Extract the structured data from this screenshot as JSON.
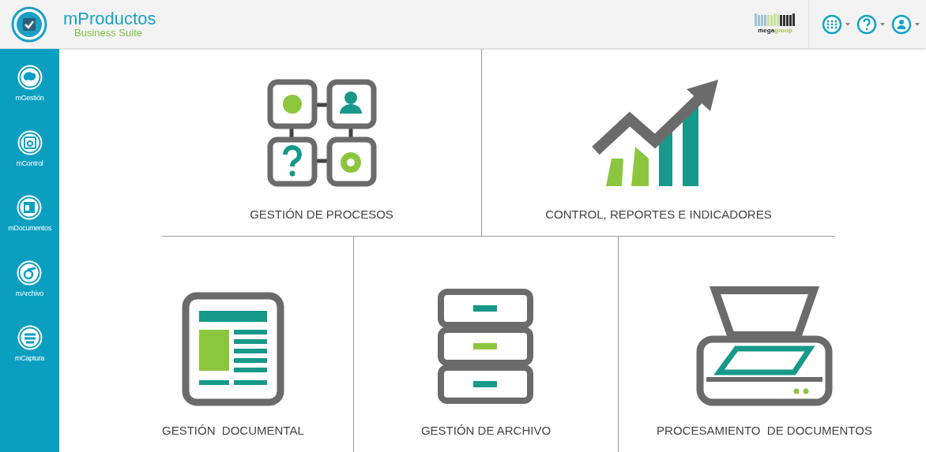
{
  "header": {
    "logo_title": "mProductos",
    "logo_subtitle": "Business Suite",
    "partner_logo": [
      "mega",
      "group"
    ]
  },
  "sidebar": {
    "items": [
      {
        "label": "mGestión",
        "kind": "gestion"
      },
      {
        "label": "mControl",
        "kind": "control"
      },
      {
        "label": "mDocumentos",
        "kind": "documentos"
      },
      {
        "label": "mArchivo",
        "kind": "archivo"
      },
      {
        "label": "mCaptura",
        "kind": "captura"
      }
    ]
  },
  "tiles_top": [
    {
      "label": "GESTIÓN DE PROCESOS",
      "kind": "procesos"
    },
    {
      "label": "CONTROL, REPORTES E INDICADORES",
      "kind": "reportes"
    }
  ],
  "tiles_bottom": [
    {
      "label": "GESTIÓN  DOCUMENTAL",
      "kind": "documental"
    },
    {
      "label": "GESTIÓN DE ARCHIVO",
      "kind": "archivo"
    },
    {
      "label": "PROCESAMIENTO  DE DOCUMENTOS",
      "kind": "escaner"
    }
  ]
}
